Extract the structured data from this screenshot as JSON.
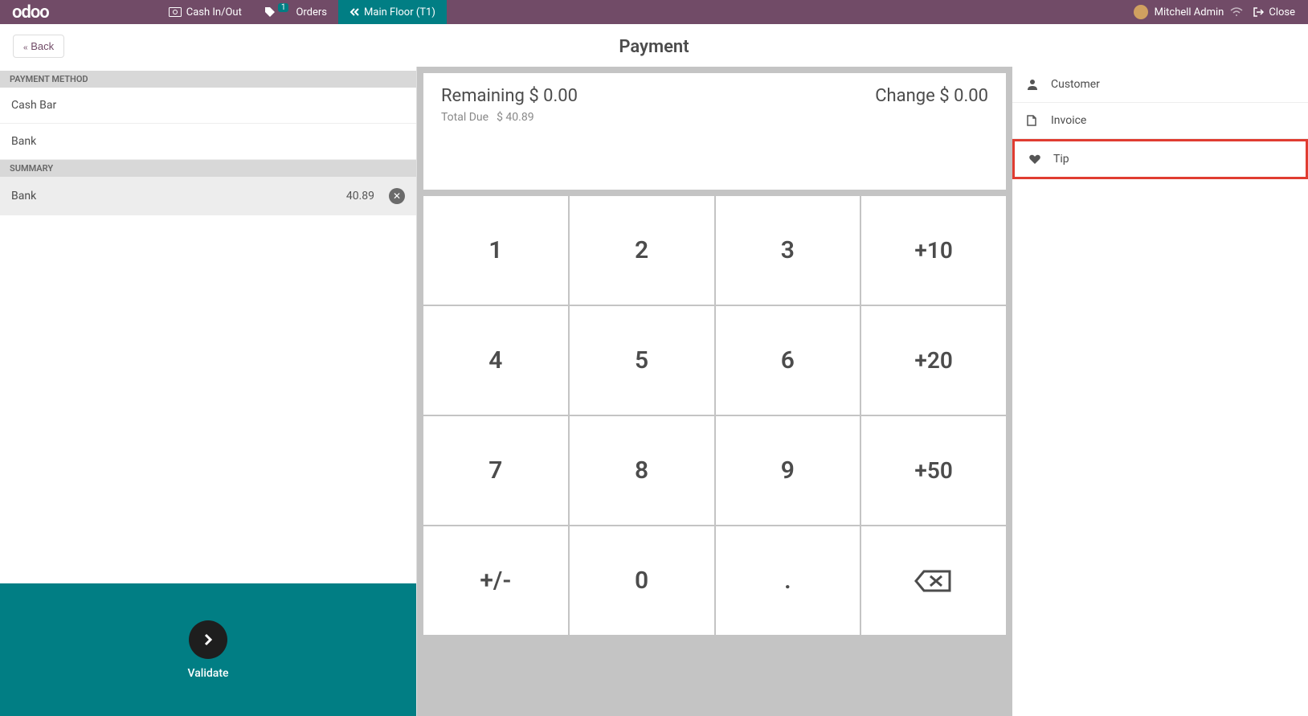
{
  "topbar": {
    "logo": "odoo",
    "cash_in_out": "Cash In/Out",
    "orders": "Orders",
    "orders_badge": "1",
    "floor": "Main Floor  (T1)",
    "user": "Mitchell Admin",
    "close": "Close"
  },
  "page": {
    "title": "Payment",
    "back_label": "Back"
  },
  "left": {
    "payment_method_header": "PAYMENT METHOD",
    "methods": [
      "Cash Bar",
      "Bank"
    ],
    "summary_header": "SUMMARY",
    "summary": [
      {
        "name": "Bank",
        "amount": "40.89"
      }
    ],
    "validate_label": "Validate"
  },
  "amounts": {
    "remaining_label": "Remaining",
    "remaining_value": "$ 0.00",
    "change_label": "Change",
    "change_value": "$ 0.00",
    "total_due_label": "Total Due",
    "total_due_value": "$ 40.89"
  },
  "numpad": {
    "k1": "1",
    "k2": "2",
    "k3": "3",
    "p10": "+10",
    "k4": "4",
    "k5": "5",
    "k6": "6",
    "p20": "+20",
    "k7": "7",
    "k8": "8",
    "k9": "9",
    "p50": "+50",
    "pm": "+/-",
    "k0": "0",
    "dot": "."
  },
  "right": {
    "customer": "Customer",
    "invoice": "Invoice",
    "tip": "Tip"
  }
}
